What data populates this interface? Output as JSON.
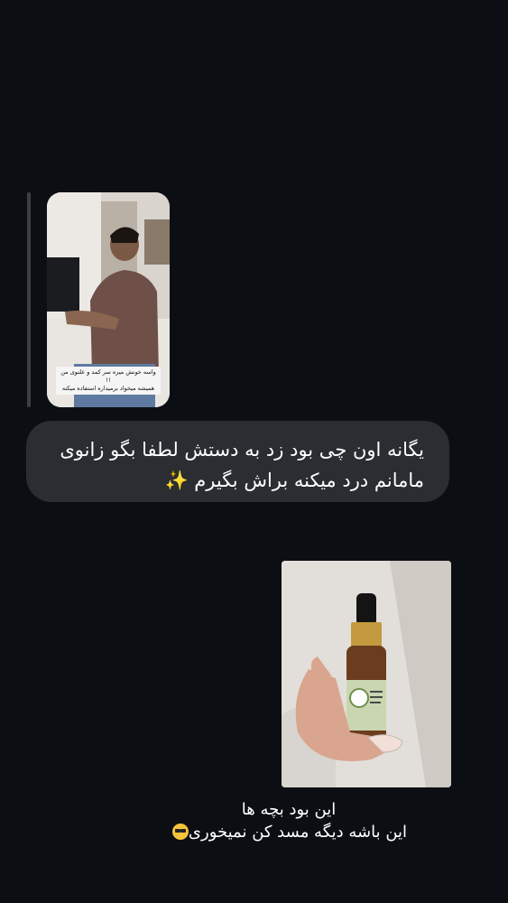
{
  "story_reply": {
    "caption_line1": "واسه خونش میره سر کمد و علنوی من !!",
    "caption_line2": "همیشه میخواد برمیداره استفاده میکنه"
  },
  "message": {
    "line1": "یگانه اون چی بود زد به دستش لطفا بگو زانوی",
    "line2": "مامانم درد میکنه براش بگیرم",
    "emoji": "✨"
  },
  "photo_caption": {
    "line1": "این بود بچه ها",
    "line2": "این باشه دیگه مسد کن نمیخوری",
    "emoji": "😎"
  }
}
